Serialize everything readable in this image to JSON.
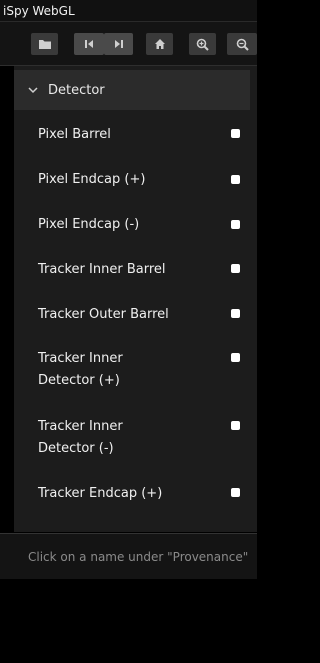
{
  "app": {
    "title": "iSpy WebGL"
  },
  "toolbar": {
    "buttons": [
      {
        "name": "open-folder-icon"
      },
      {
        "name": "first-event-icon"
      },
      {
        "name": "next-event-icon"
      },
      {
        "name": "home-icon"
      },
      {
        "name": "zoom-in-icon"
      },
      {
        "name": "zoom-out-icon"
      }
    ]
  },
  "tree": {
    "section_label": "Detector",
    "items": [
      {
        "label": "Pixel Barrel",
        "checked": true
      },
      {
        "label": "Pixel Endcap (+)",
        "checked": true
      },
      {
        "label": "Pixel Endcap (-)",
        "checked": true
      },
      {
        "label": "Tracker Inner Barrel",
        "checked": true
      },
      {
        "label": "Tracker Outer Barrel",
        "checked": true
      },
      {
        "label": "Tracker Inner Detector (+)",
        "checked": true
      },
      {
        "label": "Tracker Inner Detector (-)",
        "checked": true
      },
      {
        "label": "Tracker Endcap (+)",
        "checked": true
      }
    ]
  },
  "info": {
    "text": "Click on a name under \"Provenance\""
  },
  "colors": {
    "background": "#000000",
    "panel": "#1c1c1c",
    "header": "#2b2b2b",
    "button": "#3a3a3a"
  }
}
